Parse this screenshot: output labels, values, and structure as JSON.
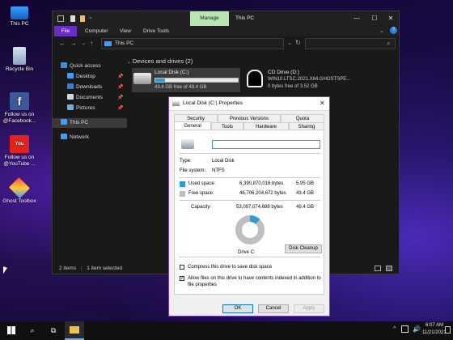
{
  "desktop": {
    "icons": [
      {
        "label": "This PC",
        "icon": "this-pc-icon"
      },
      {
        "label": "Recycle Bin",
        "icon": "recycle-bin-icon"
      },
      {
        "label": "Follow us on @Facebook...",
        "icon": "facebook-icon"
      },
      {
        "label": "Follow us on @YouTube ...",
        "icon": "youtube-icon"
      },
      {
        "label": "Ghost Toolbox",
        "icon": "ghost-toolbox-icon"
      }
    ]
  },
  "explorer": {
    "title": "This PC",
    "manage_tab": "Manage",
    "ribbon_tabs": [
      "File",
      "Computer",
      "View",
      "Drive Tools"
    ],
    "address": "This PC",
    "section_header": "Devices and drives (2)",
    "drives": [
      {
        "name": "Local Disk (C:)",
        "detail": "43.4 GB free of 49.4 GB",
        "used_fraction": 0.12
      },
      {
        "name": "CD Drive (D:)",
        "line2": "WIN10.LTSC.2021.X64.GHOSTSPE...",
        "detail": "0 bytes free of 3.52 GB"
      }
    ],
    "sidebar": [
      {
        "label": "Quick access",
        "pinned": false
      },
      {
        "label": "Desktop",
        "pinned": true
      },
      {
        "label": "Downloads",
        "pinned": true
      },
      {
        "label": "Documents",
        "pinned": true
      },
      {
        "label": "Pictures",
        "pinned": true
      },
      {
        "label": "This PC",
        "pinned": false
      },
      {
        "label": "Network",
        "pinned": false
      }
    ],
    "status": {
      "items": "2 items",
      "selected": "1 item selected"
    }
  },
  "properties": {
    "title": "Local Disk (C:) Properties",
    "tabs_row1": [
      "Security",
      "Previous Versions",
      "Quota"
    ],
    "tabs_row2": [
      "General",
      "Tools",
      "Hardware",
      "Sharing"
    ],
    "name_value": "",
    "type_label": "Type:",
    "type_value": "Local Disk",
    "fs_label": "File system:",
    "fs_value": "NTFS",
    "used_label": "Used space:",
    "used_bytes": "6,390,870,016 bytes",
    "used_gb": "5.95 GB",
    "free_label": "Free space:",
    "free_bytes": "46,706,204,672 bytes",
    "free_gb": "43.4 GB",
    "cap_label": "Capacity:",
    "cap_bytes": "53,097,074,688 bytes",
    "cap_gb": "49.4 GB",
    "drive_label": "Drive C:",
    "cleanup": "Disk Cleanup",
    "compress": "Compress this drive to save disk space",
    "index_line1": "Allow files on this drive to have contents indexed in addition to",
    "index_line2": "file properties",
    "ok": "OK",
    "cancel": "Cancel",
    "apply": "Apply",
    "used_fraction": 0.12,
    "used_color": "#26a0da",
    "free_color": "#bfbfbf"
  },
  "taskbar": {
    "time": "6:07 AM",
    "date": "11/21/2021"
  },
  "colors": {
    "accent": "#6a2cc6",
    "manage": "#b8e6b1"
  }
}
